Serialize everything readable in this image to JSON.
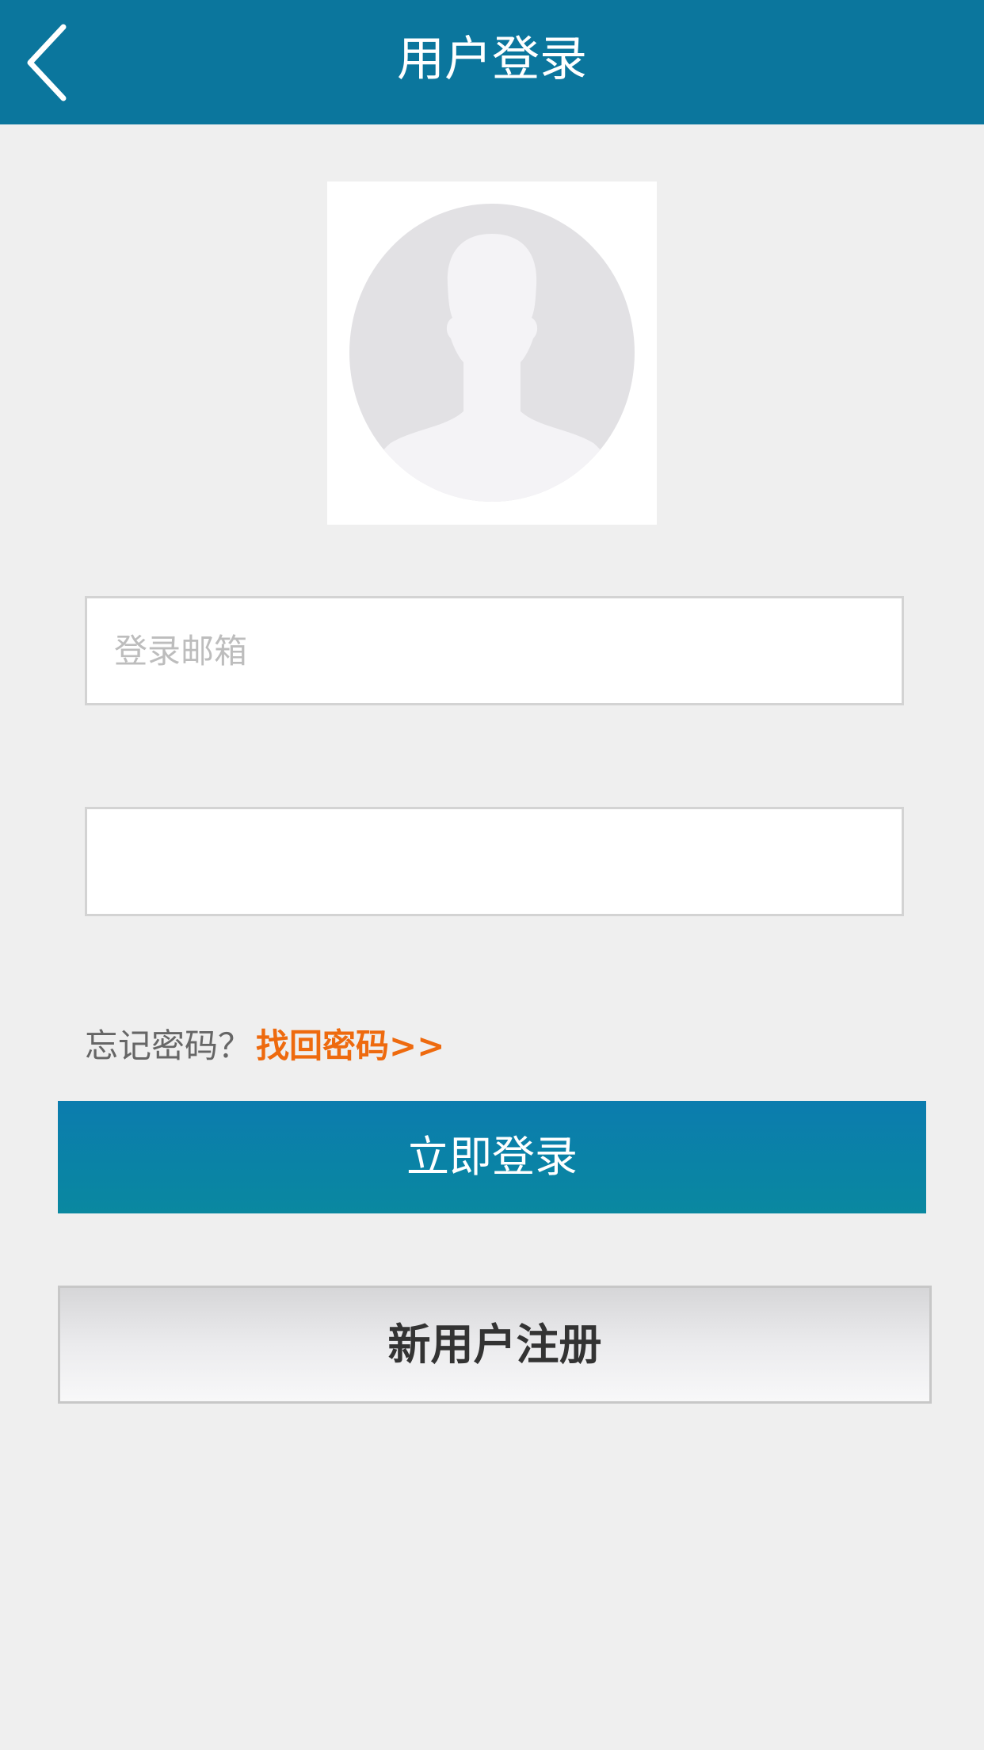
{
  "header": {
    "title": "用户登录",
    "back_icon": "chevron-left-icon",
    "background_color": "#0b769d"
  },
  "avatar": {
    "icon": "default-user-avatar-icon"
  },
  "form": {
    "email_placeholder": "登录邮箱",
    "email_value": "",
    "password_placeholder": "",
    "password_value": ""
  },
  "forgot": {
    "prompt": "忘记密码？",
    "link_label": "找回密码>>",
    "link_color": "#ee6a0e"
  },
  "actions": {
    "login_label": "立即登录",
    "login_color": "#0b7cae",
    "register_label": "新用户注册"
  }
}
